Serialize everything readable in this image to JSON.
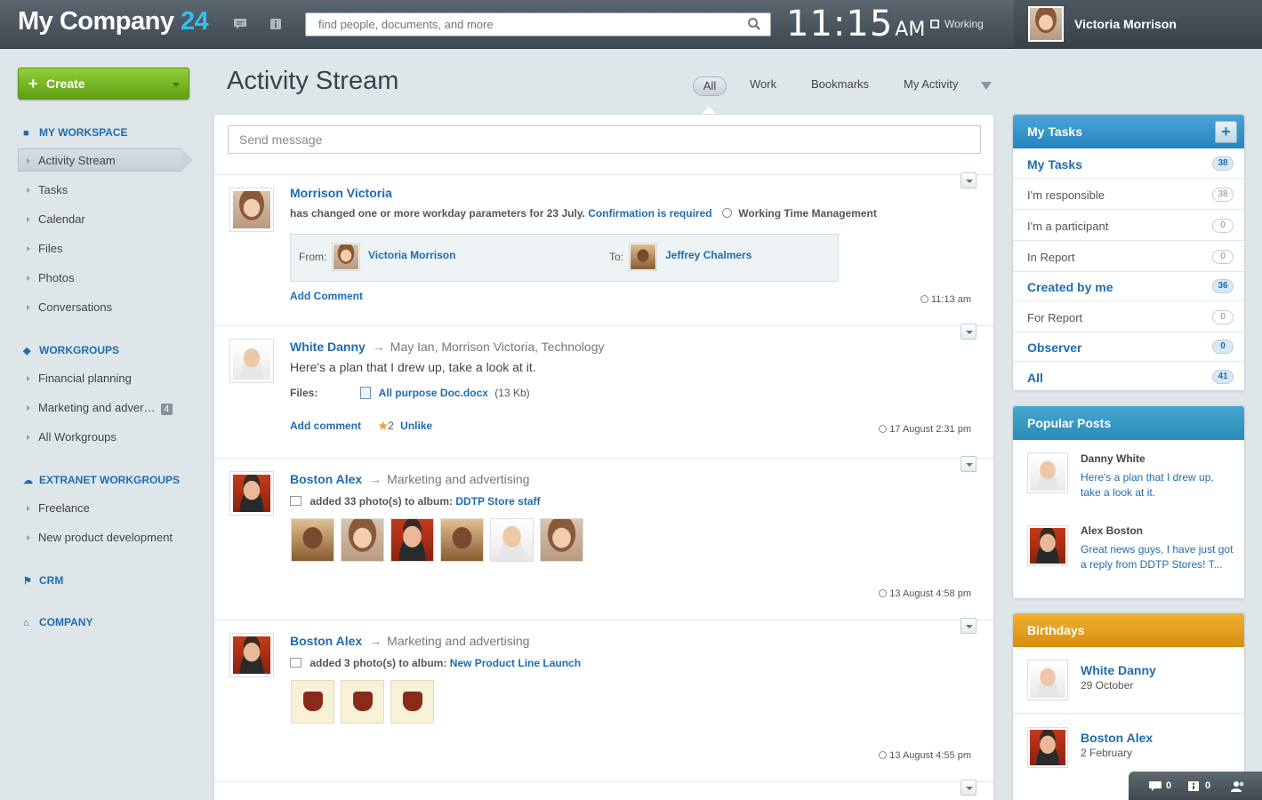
{
  "header": {
    "logo_text": "My Company",
    "logo_num": "24",
    "search_placeholder": "find people, documents, and more",
    "clock_time": "11:15",
    "clock_ampm": "AM",
    "status": "Working",
    "user_name": "Victoria Morrison"
  },
  "sidebar": {
    "create_label": "Create",
    "sections": {
      "workspace": "MY WORKSPACE",
      "workgroups": "WORKGROUPS",
      "extranet": "EXTRANET WORKGROUPS",
      "crm": "CRM",
      "company": "COMPANY"
    },
    "workspace_items": [
      "Activity Stream",
      "Tasks",
      "Calendar",
      "Files",
      "Photos",
      "Conversations"
    ],
    "workgroup_items": [
      "Financial planning",
      "Marketing and adver…",
      "All Workgroups"
    ],
    "workgroup_badge": "4",
    "extranet_items": [
      "Freelance",
      "New product development"
    ]
  },
  "main": {
    "title": "Activity Stream",
    "filters": [
      "All",
      "Work",
      "Bookmarks",
      "My Activity"
    ],
    "send_placeholder": "Send message",
    "posts": [
      {
        "author": "Morrison Victoria",
        "line": "has changed one or more workday parameters for 23 July.",
        "link": "Confirmation is required",
        "module": "Working Time Management",
        "from_label": "From:",
        "from_name": "Victoria Morrison",
        "to_label": "To:",
        "to_name": "Jeffrey Chalmers",
        "add_comment": "Add Comment",
        "time": "11:13 am"
      },
      {
        "author": "White Danny",
        "dest": "May Ian, Morrison Victoria, Technology",
        "text": "Here's a plan that I drew up, take a look at it.",
        "files_label": "Files:",
        "file_name": "All purpose Doc.docx",
        "file_size": "(13 Kb)",
        "add_comment": "Add comment",
        "likes": "2",
        "unlike": "Unlike",
        "time": "17 August 2:31 pm"
      },
      {
        "author": "Boston Alex",
        "dest": "Marketing and advertising",
        "line": "added 33 photo(s) to album:",
        "album": "DDTP Store staff",
        "time": "13 August 4:58 pm"
      },
      {
        "author": "Boston Alex",
        "dest": "Marketing and advertising",
        "line": "added 3 photo(s) to album:",
        "album": "New Product Line Launch",
        "time": "13 August 4:55 pm"
      }
    ]
  },
  "tasks": {
    "title": "My Tasks",
    "rows": [
      {
        "label": "My Tasks",
        "count": "38"
      },
      {
        "label": "I'm responsible",
        "count": "38"
      },
      {
        "label": "I'm a participant",
        "count": "0"
      },
      {
        "label": "In Report",
        "count": "0"
      },
      {
        "label": "Created by me",
        "count": "36"
      },
      {
        "label": "For Report",
        "count": "0"
      },
      {
        "label": "Observer",
        "count": "0"
      },
      {
        "label": "All",
        "count": "41"
      }
    ]
  },
  "popular": {
    "title": "Popular Posts",
    "items": [
      {
        "name": "Danny White",
        "text": "Here's a plan that I drew up, take a look at it."
      },
      {
        "name": "Alex Boston",
        "text": "Great news guys, I have just got a reply from DDTP Stores! T..."
      }
    ]
  },
  "birthdays": {
    "title": "Birthdays",
    "items": [
      {
        "name": "White Danny",
        "date": "29 October"
      },
      {
        "name": "Boston Alex",
        "date": "2 February"
      }
    ]
  },
  "bottombar": {
    "messages": "0",
    "notifications": "0"
  },
  "colors": {
    "accent": "#1f6cb0",
    "create_green": "#6fb320",
    "header": "#4a545c",
    "tasks_head": "#2f8fc8",
    "birthdays_head": "#e3a020"
  }
}
